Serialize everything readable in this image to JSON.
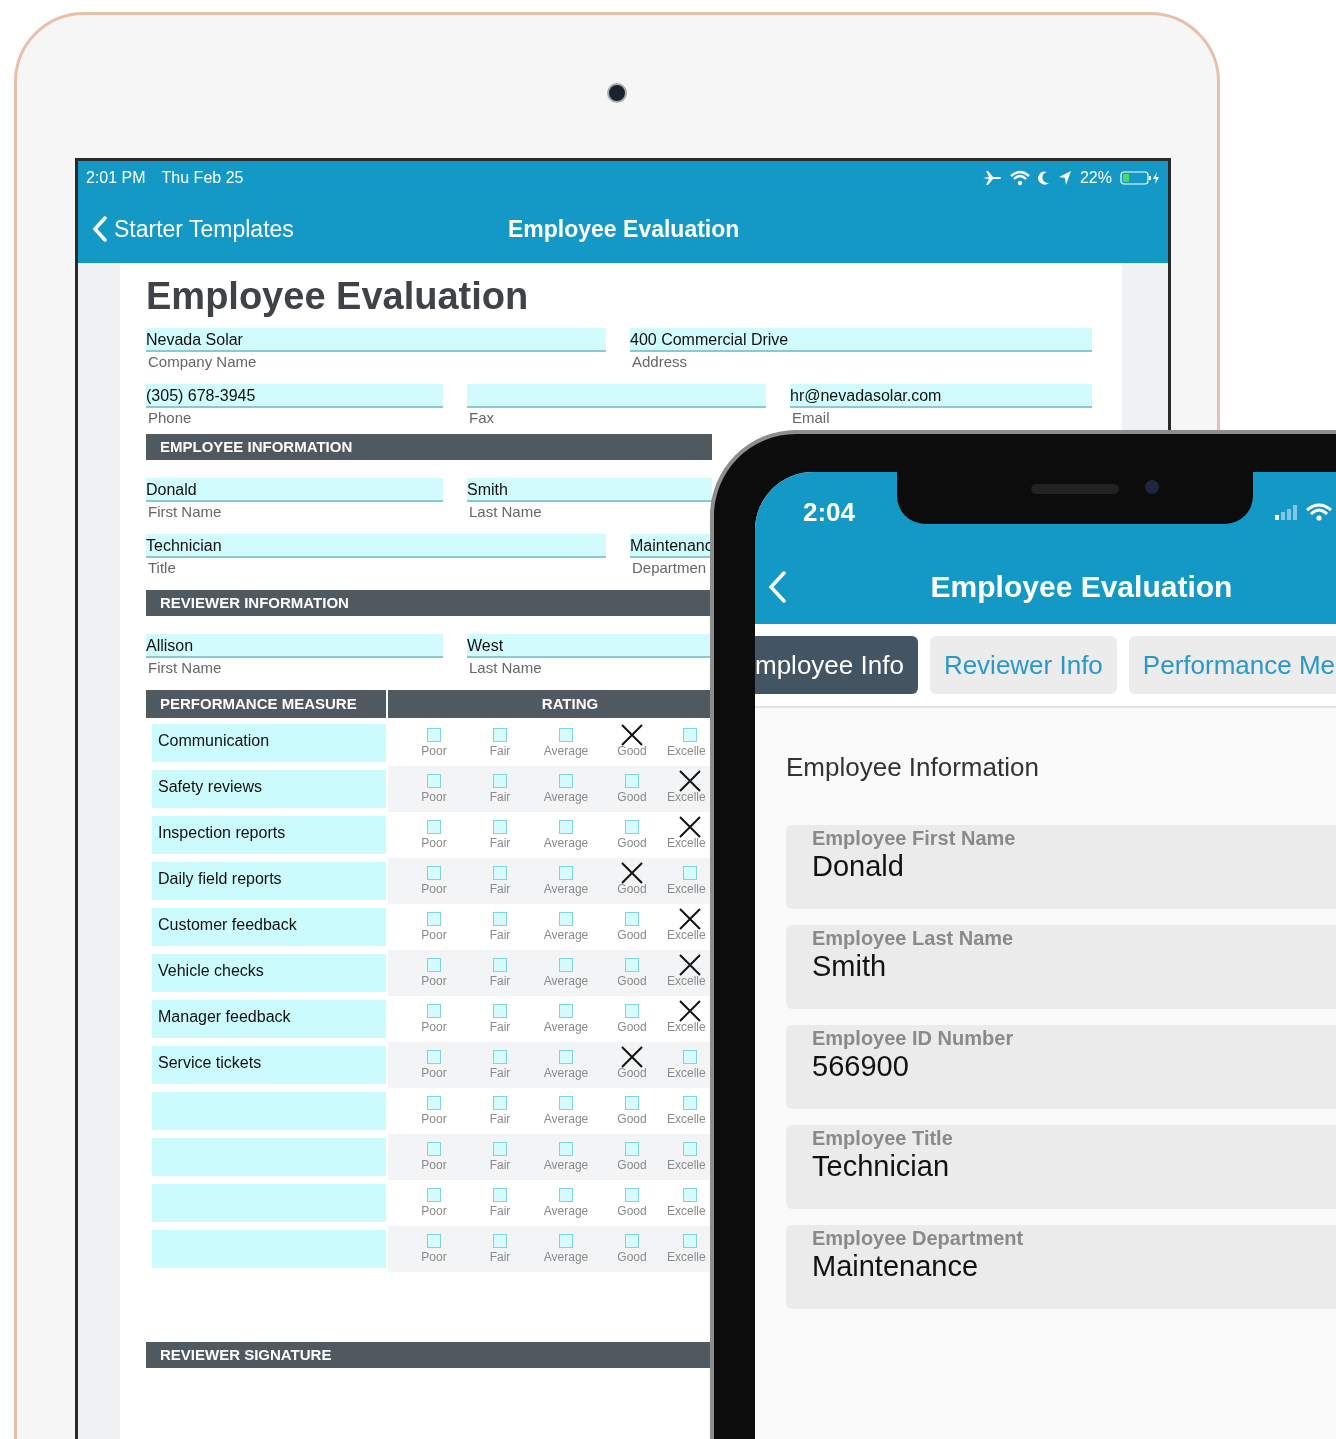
{
  "tablet": {
    "status_bar": {
      "time": "2:01 PM",
      "date": "Thu Feb 25",
      "battery": "22%"
    },
    "nav_bar": {
      "back": "Starter Templates",
      "title": "Employee Evaluation"
    },
    "form": {
      "title": "Employee Evaluation",
      "company_fields": [
        {
          "value": "Nevada Solar",
          "label": "Company Name"
        },
        {
          "value": "400 Commercial Drive",
          "label": "Address"
        }
      ],
      "contact_fields": [
        {
          "value": "(305) 678-3945",
          "label": "Phone"
        },
        {
          "label": "Fax"
        },
        {
          "value": "hr@nevadasolar.com",
          "label": "Email"
        }
      ],
      "sections": [
        {
          "heading": "EMPLOYEE INFORMATION",
          "rows": [
            [
              {
                "value": "Donald",
                "label": "First Name"
              },
              {
                "value": "Smith",
                "label": "Last Name"
              }
            ],
            [
              {
                "value": "Technician",
                "label": "Title"
              },
              {
                "value": "Maintenanc",
                "label": "Departmen"
              }
            ]
          ]
        },
        {
          "heading": "REVIEWER INFORMATION",
          "rows": [
            [
              {
                "value": "Allison",
                "label": "First Name"
              },
              {
                "value": "West",
                "label": "Last Name"
              }
            ]
          ]
        }
      ],
      "rating_table": {
        "columns": [
          "PERFORMANCE MEASURE",
          "RATING"
        ],
        "rows": [
          {
            "measure": "Communication",
            "options": [
              {
                "label": "Poor",
                "checked": false
              },
              {
                "label": "Fair",
                "checked": false
              },
              {
                "label": "Average",
                "checked": false
              },
              {
                "label": "Good",
                "checked": true
              },
              {
                "label": "Excelle",
                "checked": false
              }
            ]
          },
          {
            "measure": "Safety reviews",
            "options": [
              {
                "label": "Poor",
                "checked": false
              },
              {
                "label": "Fair",
                "checked": false
              },
              {
                "label": "Average",
                "checked": false
              },
              {
                "label": "Good",
                "checked": false
              },
              {
                "label": "Excelle",
                "checked": true
              }
            ]
          },
          {
            "measure": "Inspection reports",
            "options": [
              {
                "label": "Poor",
                "checked": false
              },
              {
                "label": "Fair",
                "checked": false
              },
              {
                "label": "Average",
                "checked": false
              },
              {
                "label": "Good",
                "checked": false
              },
              {
                "label": "Excelle",
                "checked": true
              }
            ]
          },
          {
            "measure": "Daily field reports",
            "options": [
              {
                "label": "Poor",
                "checked": false
              },
              {
                "label": "Fair",
                "checked": false
              },
              {
                "label": "Average",
                "checked": false
              },
              {
                "label": "Good",
                "checked": true
              },
              {
                "label": "Excelle",
                "checked": false
              }
            ]
          },
          {
            "measure": "Customer feedback",
            "options": [
              {
                "label": "Poor",
                "checked": false
              },
              {
                "label": "Fair",
                "checked": false
              },
              {
                "label": "Average",
                "checked": false
              },
              {
                "label": "Good",
                "checked": false
              },
              {
                "label": "Excelle",
                "checked": true
              }
            ]
          },
          {
            "measure": "Vehicle checks",
            "options": [
              {
                "label": "Poor",
                "checked": false
              },
              {
                "label": "Fair",
                "checked": false
              },
              {
                "label": "Average",
                "checked": false
              },
              {
                "label": "Good",
                "checked": false
              },
              {
                "label": "Excelle",
                "checked": true
              }
            ]
          },
          {
            "measure": "Manager feedback",
            "options": [
              {
                "label": "Poor",
                "checked": false
              },
              {
                "label": "Fair",
                "checked": false
              },
              {
                "label": "Average",
                "checked": false
              },
              {
                "label": "Good",
                "checked": false
              },
              {
                "label": "Excelle",
                "checked": true
              }
            ]
          },
          {
            "measure": "Service tickets",
            "options": [
              {
                "label": "Poor",
                "checked": false
              },
              {
                "label": "Fair",
                "checked": false
              },
              {
                "label": "Average",
                "checked": false
              },
              {
                "label": "Good",
                "checked": true
              },
              {
                "label": "Excelle",
                "checked": false
              }
            ]
          },
          {
            "options": [
              {
                "label": "Poor",
                "checked": false
              },
              {
                "label": "Fair",
                "checked": false
              },
              {
                "label": "Average",
                "checked": false
              },
              {
                "label": "Good",
                "checked": false
              },
              {
                "label": "Excelle",
                "checked": false
              }
            ]
          },
          {
            "options": [
              {
                "label": "Poor",
                "checked": false
              },
              {
                "label": "Fair",
                "checked": false
              },
              {
                "label": "Average",
                "checked": false
              },
              {
                "label": "Good",
                "checked": false
              },
              {
                "label": "Excelle",
                "checked": false
              }
            ]
          },
          {
            "options": [
              {
                "label": "Poor",
                "checked": false
              },
              {
                "label": "Fair",
                "checked": false
              },
              {
                "label": "Average",
                "checked": false
              },
              {
                "label": "Good",
                "checked": false
              },
              {
                "label": "Excelle",
                "checked": false
              }
            ]
          },
          {
            "options": [
              {
                "label": "Poor",
                "checked": false
              },
              {
                "label": "Fair",
                "checked": false
              },
              {
                "label": "Average",
                "checked": false
              },
              {
                "label": "Good",
                "checked": false
              },
              {
                "label": "Excelle",
                "checked": false
              }
            ]
          }
        ]
      },
      "signature_heading": "REVIEWER SIGNATURE"
    }
  },
  "phone": {
    "status_bar": {
      "time": "2:04"
    },
    "nav_bar": {
      "title": "Employee Evaluation"
    },
    "tabs": [
      {
        "label": "mployee Info",
        "selected": true
      },
      {
        "label": "Reviewer Info",
        "selected": false
      },
      {
        "label": "Performance Me",
        "selected": false
      }
    ],
    "section_title": "Employee Information",
    "fields": [
      {
        "label": "Employee First Name",
        "value": "Donald"
      },
      {
        "label": "Employee Last Name",
        "value": "Smith"
      },
      {
        "label": "Employee ID Number",
        "value": "566900"
      },
      {
        "label": "Employee Title",
        "value": "Technician"
      },
      {
        "label": "Employee Department",
        "value": "Maintenance"
      }
    ]
  }
}
